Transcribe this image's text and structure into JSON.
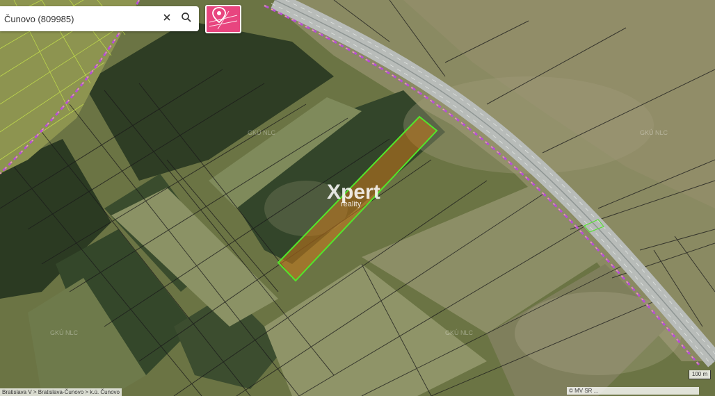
{
  "search": {
    "value": "Čunovo (809985)",
    "placeholder": ""
  },
  "icons": {
    "clear": "close-icon",
    "search": "search-icon",
    "layers": "parcel-pin-icon"
  },
  "watermark": {
    "logo_main": "Xpert",
    "logo_sub": "reality",
    "tile_mark": "GKÚ NLC"
  },
  "breadcrumb": "Bratislava V > Bratislava-Čunovo > k.ú. Čunovo",
  "attribution": "© MV SR ...",
  "scale_label": "100 m",
  "colors": {
    "highlight": "#52e62b",
    "boundary": "#b74fd8",
    "road": "#9aa0a2",
    "layers_button": "#e8457f"
  }
}
